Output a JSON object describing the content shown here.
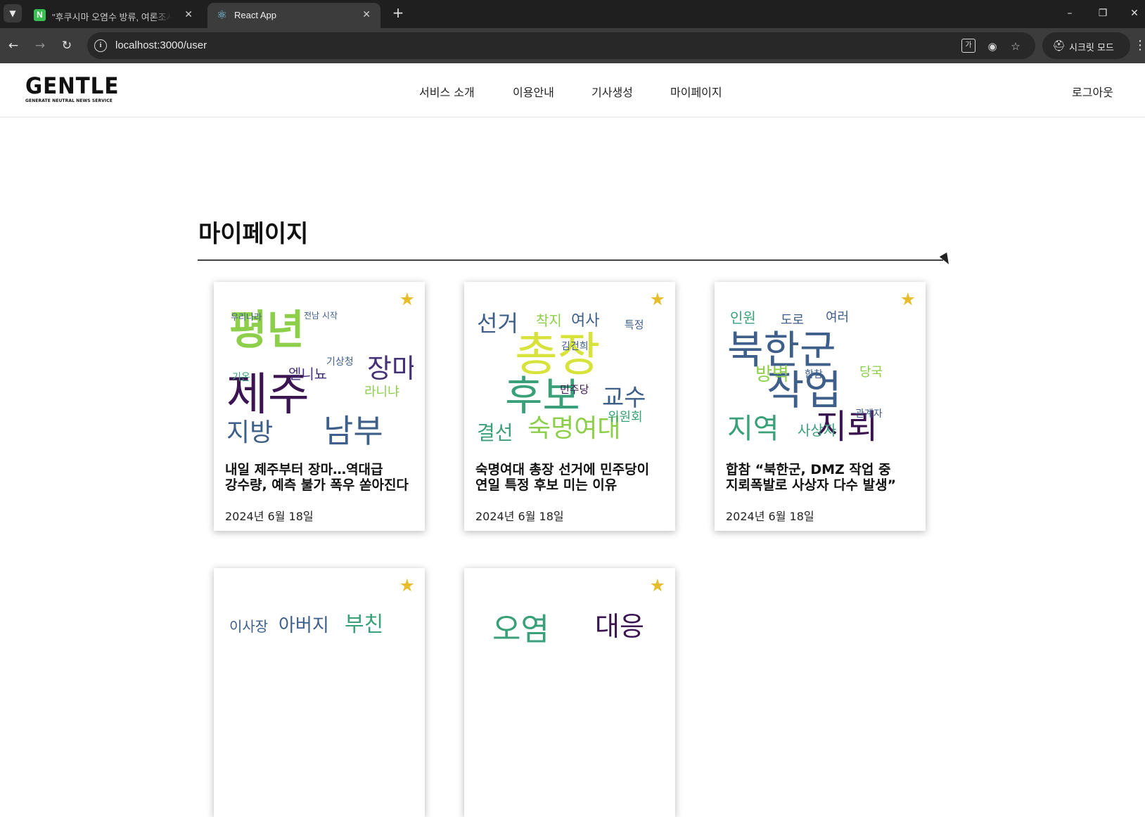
{
  "browser": {
    "tabs": [
      {
        "title": "\"후쿠시마 오염수 방류, 여론조사",
        "favicon": "naver-n-icon",
        "active": false
      },
      {
        "title": "React App",
        "favicon": "react-icon",
        "active": true
      }
    ],
    "url": "localhost:3000/user",
    "incognito_label": "시크릿 모드"
  },
  "site": {
    "logo": {
      "main": "GENTLE",
      "sub": "GENERATE NEUTRAL NEWS SERVICE"
    },
    "nav": [
      "서비스 소개",
      "이용안내",
      "기사생성",
      "마이페이지"
    ],
    "logout": "로그아웃"
  },
  "page": {
    "title": "마이페이지"
  },
  "cards": [
    {
      "title": "내일 제주부터 장마…역대급 강수량, 예측 불가 폭우 쏟아진다",
      "date": "2024년 6월 18일",
      "starred": true,
      "words": [
        {
          "t": "평년",
          "c": "#8dcf4a"
        },
        {
          "t": "제주",
          "c": "#3b1452"
        },
        {
          "t": "남부",
          "c": "#3d5f8a"
        },
        {
          "t": "지방",
          "c": "#3d5f8a"
        },
        {
          "t": "장마",
          "c": "#45307a"
        },
        {
          "t": "엘니뇨",
          "c": "#45307a"
        },
        {
          "t": "라니냐",
          "c": "#8dcf4a"
        },
        {
          "t": "기상청",
          "c": "#3d5f8a"
        },
        {
          "t": "우리나라",
          "c": "#3d5f8a"
        },
        {
          "t": "전남 시작",
          "c": "#3d5f8a"
        },
        {
          "t": "기온",
          "c": "#3aa079"
        }
      ]
    },
    {
      "title": "숙명여대 총장 선거에 민주당이 연일 특정 후보 미는 이유",
      "date": "2024년 6월 18일",
      "starred": true,
      "words": [
        {
          "t": "총장",
          "c": "#d7e33a"
        },
        {
          "t": "후보",
          "c": "#3aa079"
        },
        {
          "t": "숙명여대",
          "c": "#8dcf4a"
        },
        {
          "t": "선거",
          "c": "#3d5f8a"
        },
        {
          "t": "교수",
          "c": "#3d5f8a"
        },
        {
          "t": "결선",
          "c": "#3aa079"
        },
        {
          "t": "여사",
          "c": "#3d5f8a"
        },
        {
          "t": "착지",
          "c": "#8dcf4a"
        },
        {
          "t": "특정",
          "c": "#3d5f8a"
        },
        {
          "t": "위원회",
          "c": "#3aa079"
        },
        {
          "t": "민주당",
          "c": "#3b1452"
        },
        {
          "t": "김건희",
          "c": "#3d5f8a"
        }
      ]
    },
    {
      "title": "합참 “북한군, DMZ 작업 중 지뢰폭발로 사상자 다수 발생”",
      "date": "2024년 6월 18일",
      "starred": true,
      "words": [
        {
          "t": "북한군",
          "c": "#3d5f8a"
        },
        {
          "t": "지뢰",
          "c": "#3b1452"
        },
        {
          "t": "작업",
          "c": "#3d5f8a"
        },
        {
          "t": "지역",
          "c": "#3aa079"
        },
        {
          "t": "방벽",
          "c": "#8dcf4a"
        },
        {
          "t": "사상자",
          "c": "#3aa079"
        },
        {
          "t": "인원",
          "c": "#3aa079"
        },
        {
          "t": "도로",
          "c": "#3d5f8a"
        },
        {
          "t": "여러",
          "c": "#3d5f8a"
        },
        {
          "t": "합참",
          "c": "#3d5f8a"
        },
        {
          "t": "당국",
          "c": "#8dcf4a"
        },
        {
          "t": "관계자",
          "c": "#3d5f8a"
        }
      ]
    },
    {
      "title": "",
      "date": "",
      "starred": true,
      "words": [
        {
          "t": "이사장",
          "c": "#3d5f8a"
        },
        {
          "t": "아버지",
          "c": "#3d5f8a"
        },
        {
          "t": "부친",
          "c": "#3aa079"
        }
      ]
    },
    {
      "title": "",
      "date": "",
      "starred": true,
      "words": [
        {
          "t": "대응",
          "c": "#3b1452"
        },
        {
          "t": "오염",
          "c": "#3aa079"
        }
      ]
    }
  ]
}
